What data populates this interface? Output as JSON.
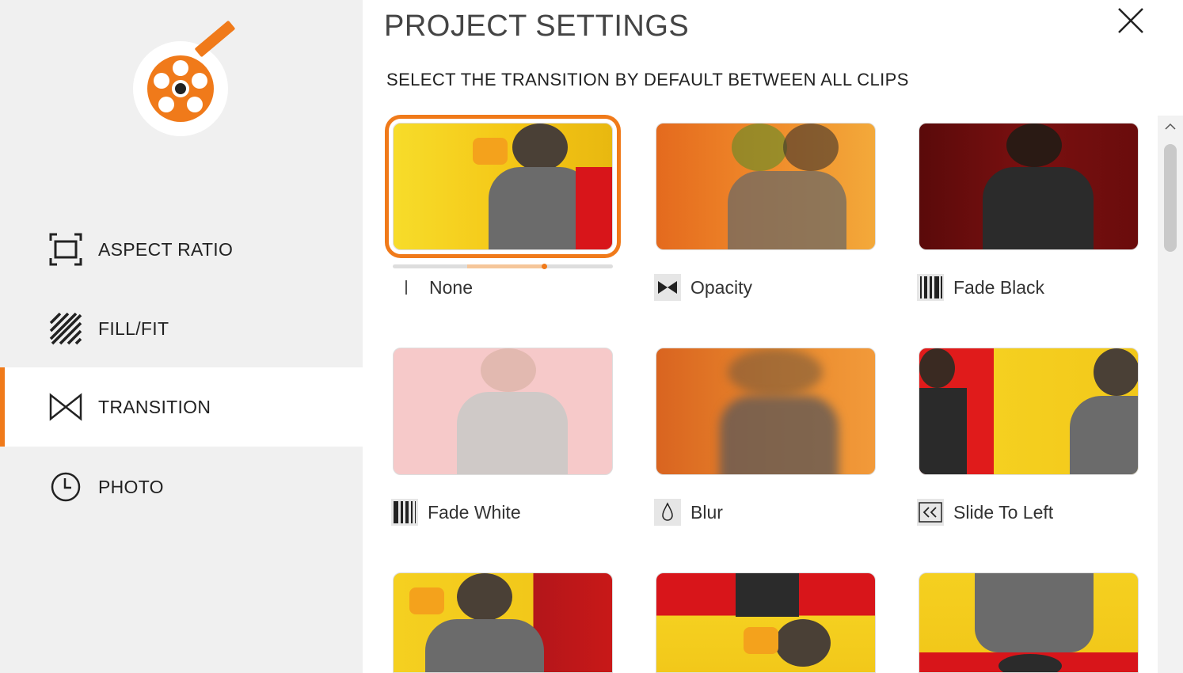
{
  "header": {
    "title": "PROJECT SETTINGS",
    "subtitle": "SELECT THE TRANSITION BY DEFAULT BETWEEN ALL CLIPS"
  },
  "sidebar": {
    "items": [
      {
        "label": "ASPECT RATIO",
        "icon": "aspect-ratio-icon"
      },
      {
        "label": "FILL/FIT",
        "icon": "fill-fit-icon"
      },
      {
        "label": "TRANSITION",
        "icon": "transition-icon",
        "active": true
      },
      {
        "label": "PHOTO",
        "icon": "clock-icon"
      }
    ]
  },
  "transitions": [
    {
      "label": "None",
      "icon": "none-icon",
      "selected": true
    },
    {
      "label": "Opacity",
      "icon": "opacity-icon"
    },
    {
      "label": "Fade Black",
      "icon": "fade-black-icon"
    },
    {
      "label": "Fade White",
      "icon": "fade-white-icon"
    },
    {
      "label": "Blur",
      "icon": "blur-drop-icon"
    },
    {
      "label": "Slide To Left",
      "icon": "slide-left-icon"
    }
  ],
  "preview": {
    "progress": 0.68
  },
  "colors": {
    "accent": "#f07a1a",
    "sidebar": "#f0f0f0",
    "yellow": "#f5d020",
    "red": "#d8151a"
  }
}
